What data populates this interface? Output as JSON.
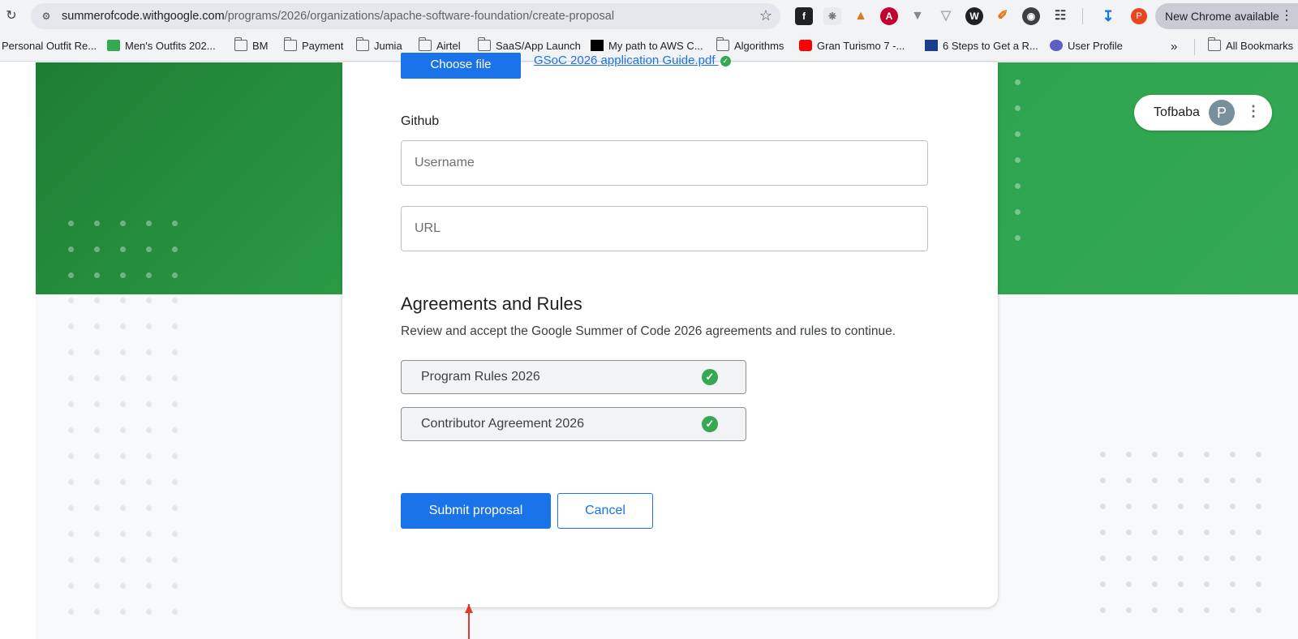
{
  "browser": {
    "url_host": "summerofcode.withgoogle.com",
    "url_path": "/programs/2026/organizations/apache-software-foundation/create-proposal",
    "new_chrome_label": "New Chrome available",
    "profile_initial": "P",
    "bookmarks": [
      {
        "label": "Personal Outfit Re...",
        "icon": "folder-icon"
      },
      {
        "label": "Men's Outfits 202...",
        "icon": "bookmark-icon"
      },
      {
        "label": "BM",
        "icon": "folder-icon"
      },
      {
        "label": "Payment",
        "icon": "folder-icon"
      },
      {
        "label": "Jumia",
        "icon": "folder-icon"
      },
      {
        "label": "Airtel",
        "icon": "folder-icon"
      },
      {
        "label": "SaaS/App Launch",
        "icon": "folder-icon"
      },
      {
        "label": "My path to AWS C...",
        "icon": "medium-icon"
      },
      {
        "label": "Algorithms",
        "icon": "folder-icon"
      },
      {
        "label": "Gran Turismo 7 -...",
        "icon": "youtube-icon"
      },
      {
        "label": "6 Steps to Get a R...",
        "icon": "bookmark-icon"
      },
      {
        "label": "User Profile",
        "icon": "bookmark-icon"
      }
    ],
    "all_bookmarks_label": "All Bookmarks",
    "overflow_label": "»"
  },
  "form": {
    "file_button_label": "Choose file",
    "file_name": "GSoC 2026 application Guide.pdf",
    "github_label": "Github",
    "username_placeholder": "Username",
    "url_placeholder": "URL",
    "agreements_title": "Agreements and Rules",
    "agreements_desc": "Review and accept the Google Summer of Code 2026 agreements and rules to continue.",
    "agreements": [
      {
        "label": "Program Rules 2026",
        "accepted": true
      },
      {
        "label": "Contributor Agreement 2026",
        "accepted": true
      }
    ],
    "submit_label": "Submit proposal",
    "cancel_label": "Cancel"
  },
  "user": {
    "name": "Tofbaba",
    "initial": "P"
  },
  "colors": {
    "brand_green": "#34a853",
    "primary_blue": "#1a73e8",
    "annotation_red": "#e5372c"
  }
}
